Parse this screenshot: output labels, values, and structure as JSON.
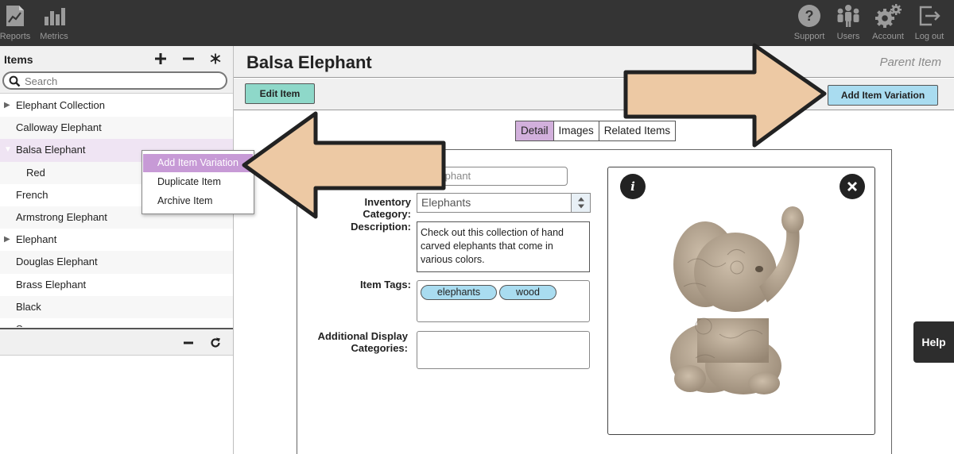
{
  "topbar": {
    "left_nav": [
      {
        "label": "Reports",
        "icon": "reports-icon"
      },
      {
        "label": "Metrics",
        "icon": "metrics-icon"
      }
    ],
    "right_nav": [
      {
        "label": "Support",
        "icon": "support-icon"
      },
      {
        "label": "Users",
        "icon": "users-icon"
      },
      {
        "label": "Account",
        "icon": "account-gear-icon"
      },
      {
        "label": "Log out",
        "icon": "logout-icon"
      }
    ]
  },
  "sidebar": {
    "title": "Items",
    "search_placeholder": "Search",
    "items": [
      {
        "label": "Elephant Collection",
        "expander": "collapsed"
      },
      {
        "label": "Calloway Elephant"
      },
      {
        "label": "Balsa Elephant",
        "expander": "expanded",
        "selected": true
      },
      {
        "label": "Red",
        "child": true
      },
      {
        "label": "French"
      },
      {
        "label": "Armstrong Elephant"
      },
      {
        "label": "Elephant",
        "expander": "collapsed"
      },
      {
        "label": "Douglas Elephant"
      },
      {
        "label": "Brass Elephant"
      },
      {
        "label": "Black"
      },
      {
        "label": "Sage"
      }
    ]
  },
  "context_menu": {
    "items": [
      {
        "label": "Add Item Variation",
        "active": true
      },
      {
        "label": "Duplicate Item"
      },
      {
        "label": "Archive Item"
      }
    ]
  },
  "main": {
    "title": "Balsa Elephant",
    "parent_label": "Parent Item",
    "edit_button": "Edit Item",
    "add_variation_button": "Add Item Variation",
    "tabs": [
      {
        "label": "Detail",
        "active": true
      },
      {
        "label": "Images"
      },
      {
        "label": "Related Items"
      }
    ]
  },
  "form": {
    "name_value": "a Elephant",
    "category_label": "Inventory Category:",
    "category_value": "Elephants",
    "description_label": "Description:",
    "description_value": "Check out this collection of hand carved elephants that come in various colors.",
    "tags_label": "Item Tags:",
    "tags": [
      "elephants",
      "wood"
    ],
    "display_categories_label_1": "Additional Display",
    "display_categories_label_2": "Categories:"
  },
  "help_button": "Help",
  "colors": {
    "topbar_bg": "#343434",
    "edit_button": "#8ed8c9",
    "add_variation_button": "#a9dcf0",
    "selected_row": "#efe4f3",
    "active_tab": "#d2b0dc",
    "context_active": "#c79ad6",
    "tag": "#a9dcf0",
    "arrow_fill": "#edc9a4"
  }
}
